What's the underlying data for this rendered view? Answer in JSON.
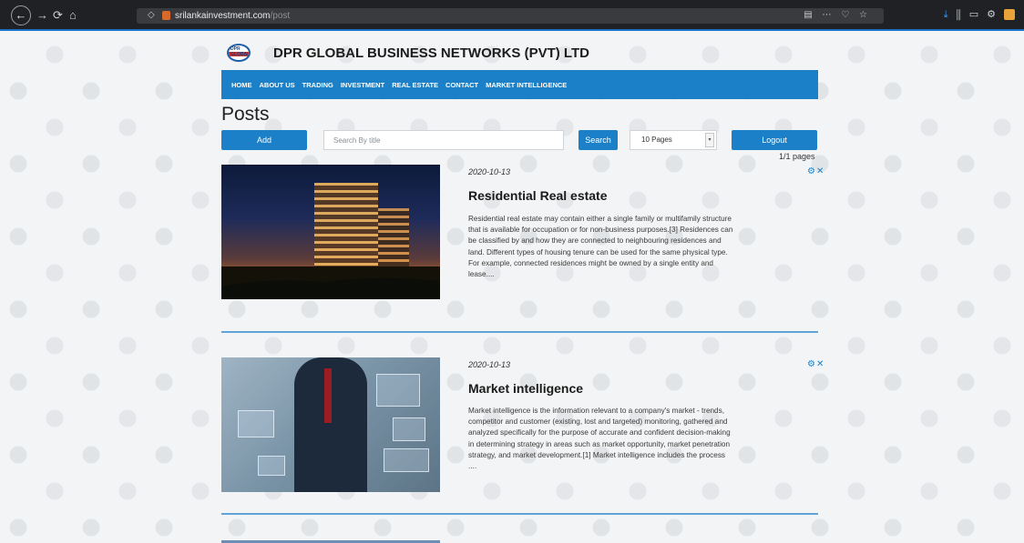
{
  "browser": {
    "url_host": "srilankainvestment.com",
    "url_path": "/post"
  },
  "site": {
    "logo_text": "DPR GLOBAL",
    "title": "DPR GLOBAL BUSINESS NETWORKS (PVT) LTD"
  },
  "nav": {
    "items": [
      "HOME",
      "ABOUT US",
      "TRADING",
      "INVESTMENT",
      "REAL ESTATE",
      "CONTACT",
      "MARKET INTELLIGENCE"
    ]
  },
  "page": {
    "heading": "Posts"
  },
  "controls": {
    "add_label": "Add",
    "search_placeholder": "Search By title",
    "search_label": "Search",
    "page_size_value": "10 Pages",
    "logout_label": "Logout",
    "pages_text": "1/1 pages"
  },
  "posts": [
    {
      "date": "2020-10-13",
      "title": "Residential Real estate",
      "excerpt": "Residential real estate may contain either a single family or multifamily structure that is available for occupation or for non-business purposes.[3] Residences can be classified by and how they are connected to neighbouring residences and land. Different types of housing tenure can be used for the same physical type. For example, connected residences might be owned by a single entity and lease....",
      "actions": "⚙✕"
    },
    {
      "date": "2020-10-13",
      "title": "Market intelligence",
      "excerpt": "Market intelligence is the information relevant to a company's market - trends, competitor and customer (existing, lost and targeted) monitoring, gathered and analyzed specifically for the purpose of accurate and confident decision-making in determining strategy in areas such as market opportunity, market penetration strategy, and market development.[1] Market intelligence includes the process ....",
      "actions": "⚙✕"
    }
  ],
  "colors": {
    "accent": "#1b80c8",
    "divider": "#5ea4d6"
  }
}
